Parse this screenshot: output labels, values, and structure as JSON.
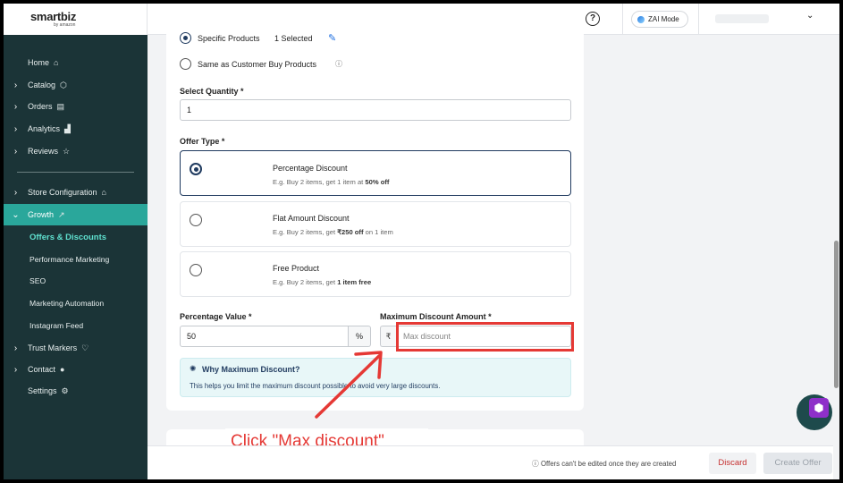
{
  "brand": {
    "logo": "smartbiz",
    "logo_sub": "by amazon"
  },
  "sidebar": {
    "items": [
      {
        "label": "Home",
        "icon": "home-icon"
      },
      {
        "label": "Catalog",
        "icon": "cube-icon"
      },
      {
        "label": "Orders",
        "icon": "receipt-icon"
      },
      {
        "label": "Analytics",
        "icon": "chart-icon"
      },
      {
        "label": "Reviews",
        "icon": "star-icon"
      },
      {
        "label": "Store Configuration",
        "icon": "store-icon"
      },
      {
        "label": "Growth",
        "icon": "trend-up-icon"
      },
      {
        "label": "Trust Markers",
        "icon": "shield-check-icon"
      },
      {
        "label": "Contact",
        "icon": "chat-icon"
      },
      {
        "label": "Settings",
        "icon": "gear-icon"
      }
    ],
    "growth_sub": [
      "Offers & Discounts",
      "Performance Marketing",
      "SEO",
      "Marketing Automation",
      "Instagram Feed"
    ]
  },
  "header": {
    "zai_label": "ZAI Mode"
  },
  "form": {
    "specific_products": "Specific Products",
    "selected_count": "1 Selected",
    "same_as_customer": "Same as Customer Buy Products",
    "quantity_label": "Select Quantity *",
    "quantity_value": "1",
    "offer_type_label": "Offer Type *",
    "options": [
      {
        "title": "Percentage Discount",
        "desc_pre": "E.g. Buy 2 items, get  1 item at ",
        "desc_bold": "50% off",
        "desc_post": ""
      },
      {
        "title": "Flat Amount Discount",
        "desc_pre": "E.g. Buy 2 items, get ",
        "desc_bold": "₹250 off",
        "desc_post": " on 1 item"
      },
      {
        "title": "Free Product",
        "desc_pre": "E.g. Buy 2 items, get ",
        "desc_bold": "1 item free",
        "desc_post": ""
      }
    ],
    "percentage_label": "Percentage Value *",
    "percentage_value": "50",
    "percent_suffix": "%",
    "max_label": "Maximum Discount Amount *",
    "currency_prefix": "₹",
    "max_placeholder": "Max discount",
    "info_title": "Why Maximum Discount?",
    "info_text": "This helps you limit the maximum discount possible to avoid very large discounts."
  },
  "annotation": "Click \"Max discount\"",
  "footer": {
    "note": "Offers can't be edited once they are created",
    "discard": "Discard",
    "create": "Create Offer"
  }
}
